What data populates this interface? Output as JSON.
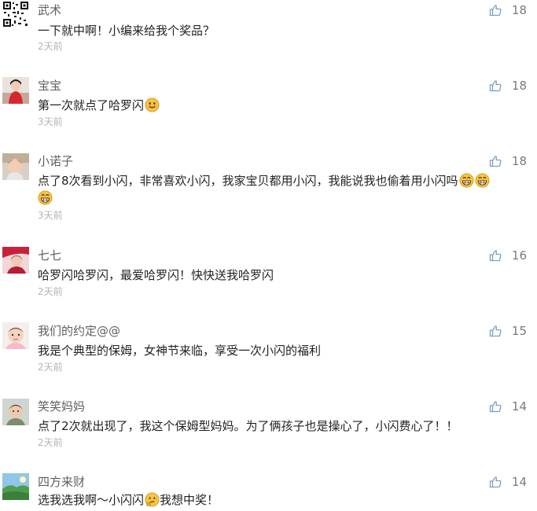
{
  "comments": [
    {
      "name": "武术",
      "text": "一下就中啊！小编来给我个奖品？",
      "time": "2天前",
      "likes": "18",
      "avatar": "qr-code-avatar"
    },
    {
      "name": "宝宝",
      "text": "第一次就点了哈罗闪",
      "time": "3天前",
      "likes": "18",
      "avatar": "person-avatar"
    },
    {
      "name": "小诺子",
      "text": "点了8次看到小闪，非常喜欢小闪，我家宝贝都用小闪，我能说我也偷着用小闪吗",
      "time": "3天前",
      "likes": "18",
      "avatar": "child-avatar"
    },
    {
      "name": "七七",
      "text": "哈罗闪哈罗闪，最爱哈罗闪！快快送我哈罗闪",
      "time": "2天前",
      "likes": "16",
      "avatar": "person-avatar"
    },
    {
      "name": "我们的约定@@",
      "text": "我是个典型的保姆，女神节来临，享受一次小闪的福利",
      "time": "2天前",
      "likes": "15",
      "avatar": "baby-avatar"
    },
    {
      "name": "笑笑妈妈",
      "text": "点了2次就出现了，我这个保姆型妈妈。为了俩孩子也是操心了，小闪费心了！！",
      "time": "2天前",
      "likes": "14",
      "avatar": "child-avatar"
    },
    {
      "name": "四方来财",
      "text": "选我选我啊～小闪闪",
      "text2": "我想中奖！",
      "likes": "14",
      "avatar": "landscape-avatar"
    }
  ],
  "icons": {
    "like": "thumbs-up-icon",
    "smile": "smile-emoji",
    "grin": "grin-emoji",
    "think": "thinking-emoji"
  },
  "colors": {
    "name": "#5f5f5f",
    "text": "#222222",
    "time": "#b4b4b4",
    "like": "#7a9ec5"
  }
}
